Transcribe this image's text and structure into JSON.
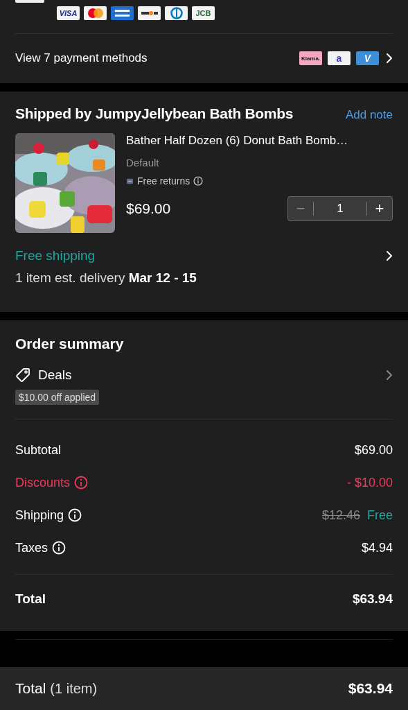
{
  "payment": {
    "card_logos": [
      {
        "kind": "visa",
        "label": "VISA"
      },
      {
        "kind": "mastercard"
      },
      {
        "kind": "amex"
      },
      {
        "kind": "discover"
      },
      {
        "kind": "diners"
      },
      {
        "kind": "jcb",
        "label": "JCB"
      }
    ],
    "view_methods": "View 7 payment methods",
    "method_logos": [
      {
        "kind": "klarna",
        "label": "Klarna."
      },
      {
        "kind": "affirm",
        "label": "a"
      },
      {
        "kind": "venmo",
        "label": "V"
      }
    ]
  },
  "shipment": {
    "title": "Shipped by JumpyJellybean Bath Bombs",
    "add_note": "Add note",
    "product": {
      "kind": "picture",
      "name": "Bather Half Dozen (6) Donut Bath Bomb…",
      "variant": "Default",
      "returns": "Free returns",
      "price": "$69.00",
      "minus": "−",
      "quantity": "1",
      "plus": "+"
    },
    "shipping_label": "Free shipping",
    "delivery_text": "1 item est. delivery ",
    "delivery_dates": "Mar 12 - 15"
  },
  "order_summary": {
    "title": "Order summary",
    "deals_label": "Deals",
    "deals_badge": "$10.00 off applied",
    "rows": [
      {
        "kind": "plain",
        "label": "Subtotal",
        "info": false,
        "value": "$69.00"
      },
      {
        "kind": "discount",
        "label": "Discounts",
        "info": true,
        "value": "- $10.00"
      },
      {
        "kind": "shipping",
        "label": "Shipping",
        "info": true,
        "original": "$12.46",
        "value": "Free"
      },
      {
        "kind": "plain",
        "label": "Taxes",
        "info": true,
        "value": "$4.94"
      }
    ],
    "total_label": "Total",
    "total_value": "$63.94"
  },
  "bottom_bar": {
    "label": "Total",
    "count": "(1 item)",
    "value": "$63.94"
  }
}
